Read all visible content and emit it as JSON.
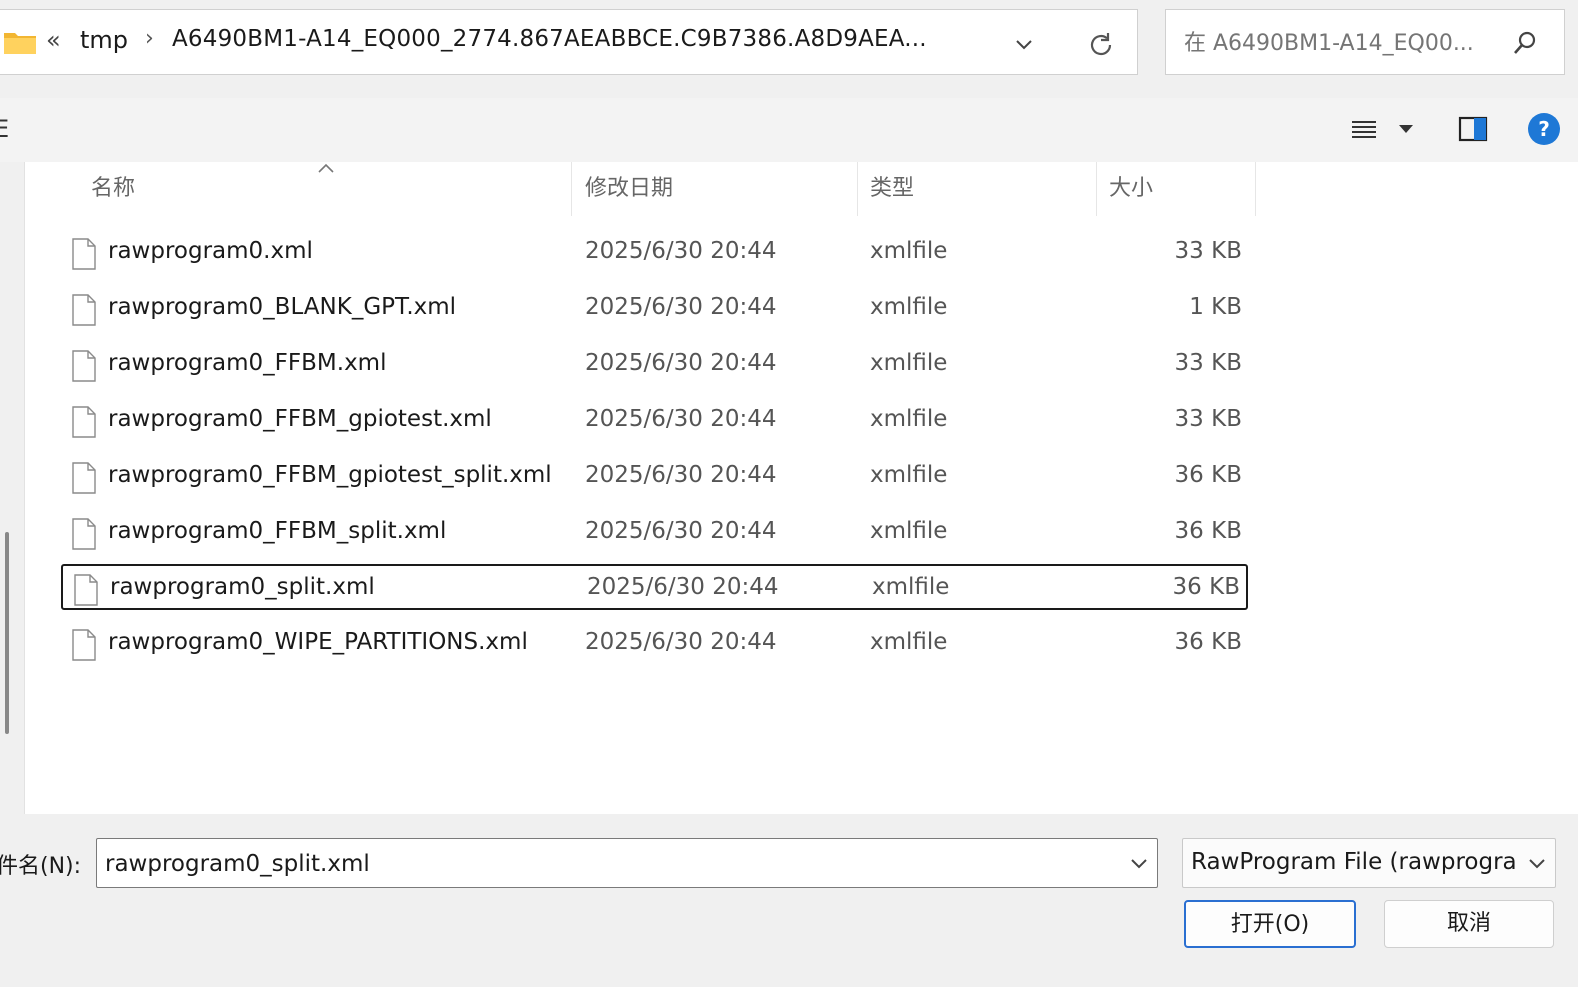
{
  "address_bar": {
    "overflow": "«",
    "crumb_tmp": "tmp",
    "crumb_arrow": "›",
    "current_folder": "A6490BM1-A14_EQ000_2774.867AEABBCE.C9B7386.A8D9AEA..."
  },
  "search": {
    "placeholder": "在 A6490BM1-A14_EQ00..."
  },
  "toolbar": {
    "left_edge": "E",
    "help": "?"
  },
  "columns": {
    "name": "名称",
    "date": "修改日期",
    "type": "类型",
    "size": "大小"
  },
  "files": [
    {
      "name": "rawprogram0.xml",
      "date": "2025/6/30 20:44",
      "type": "xmlfile",
      "size": "33 KB"
    },
    {
      "name": "rawprogram0_BLANK_GPT.xml",
      "date": "2025/6/30 20:44",
      "type": "xmlfile",
      "size": "1 KB"
    },
    {
      "name": "rawprogram0_FFBM.xml",
      "date": "2025/6/30 20:44",
      "type": "xmlfile",
      "size": "33 KB"
    },
    {
      "name": "rawprogram0_FFBM_gpiotest.xml",
      "date": "2025/6/30 20:44",
      "type": "xmlfile",
      "size": "33 KB"
    },
    {
      "name": "rawprogram0_FFBM_gpiotest_split.xml",
      "date": "2025/6/30 20:44",
      "type": "xmlfile",
      "size": "36 KB"
    },
    {
      "name": "rawprogram0_FFBM_split.xml",
      "date": "2025/6/30 20:44",
      "type": "xmlfile",
      "size": "36 KB"
    },
    {
      "name": "rawprogram0_split.xml",
      "date": "2025/6/30 20:44",
      "type": "xmlfile",
      "size": "36 KB",
      "selected": true
    },
    {
      "name": "rawprogram0_WIPE_PARTITIONS.xml",
      "date": "2025/6/30 20:44",
      "type": "xmlfile",
      "size": "36 KB"
    }
  ],
  "filename": {
    "label": "件名(N):",
    "value": "rawprogram0_split.xml"
  },
  "filetype": {
    "value": "RawProgram File (rawprogra"
  },
  "buttons": {
    "open": "打开(O)",
    "cancel": "取消"
  },
  "colors": {
    "accent": "#2a6fd1",
    "help": "#1e78d6",
    "folder": "#f2b632"
  }
}
